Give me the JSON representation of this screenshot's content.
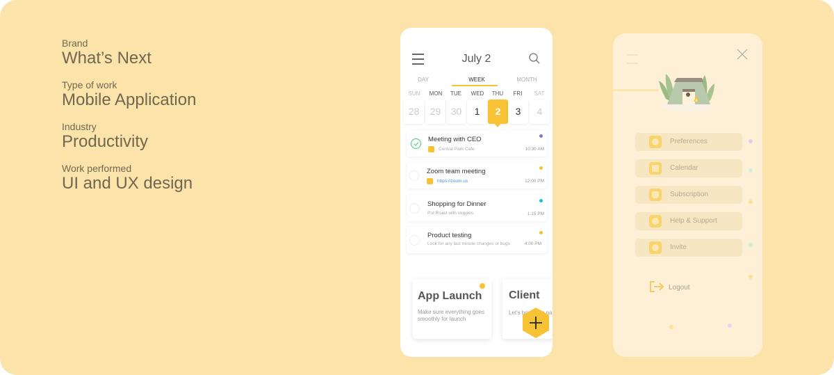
{
  "info": {
    "items": [
      {
        "label": "Brand",
        "value": "What’s Next"
      },
      {
        "label": "Type of work",
        "value": "Mobile Application"
      },
      {
        "label": "Industry",
        "value": "Productivity"
      },
      {
        "label": "Work performed",
        "value": "UI and UX design"
      }
    ]
  },
  "calendar": {
    "title": "July 2",
    "icons": {
      "menu": "menu-icon",
      "search": "search-icon"
    },
    "tabs": [
      {
        "label": "DAY",
        "active": false
      },
      {
        "label": "WEEK",
        "active": true
      },
      {
        "label": "MONTH",
        "active": false
      }
    ],
    "weekdays": [
      "SUN",
      "MON",
      "TUE",
      "WED",
      "THU",
      "FRI",
      "SAT"
    ],
    "days": [
      {
        "num": "28",
        "state": "past"
      },
      {
        "num": "29",
        "state": "past"
      },
      {
        "num": "30",
        "state": "past"
      },
      {
        "num": "1",
        "state": "normal"
      },
      {
        "num": "2",
        "state": "active"
      },
      {
        "num": "3",
        "state": "normal"
      },
      {
        "num": "4",
        "state": "past"
      }
    ],
    "events": [
      {
        "title": "Meeting with CEO",
        "subtitle": "Central Park Cafe",
        "subtitle_icon": "location-pin-icon",
        "time": "10:30 AM",
        "done": true,
        "dot_color": "#8b6fd9"
      },
      {
        "title": "Zoom team meeting",
        "subtitle": "https://zoom.us",
        "subtitle_icon": "link-icon",
        "time": "12:00 PM",
        "done": false,
        "dot_color": "#f7c334"
      },
      {
        "title": "Shopping for Dinner",
        "subtitle": "Pot Roast with veggies",
        "time": "1:15 PM",
        "done": false,
        "dot_color": "#1cc2d6"
      },
      {
        "title": "Product testing",
        "subtitle": "Look for any last minute changes or bugs",
        "time": "4:00 PM",
        "done": false,
        "dot_color": "#f7c334"
      }
    ],
    "projects": [
      {
        "title": "App Launch",
        "description_line1": "Make sure everything goes",
        "description_line2": "smoothly for launch"
      },
      {
        "title": "Client",
        "description_line1": "Let's bring this ga",
        "description_line2": ""
      }
    ],
    "fab_icon": "plus-icon"
  },
  "side_menu": {
    "close_icon": "close-icon",
    "illustration": "camping-tent-illustration",
    "items": [
      {
        "label": "Preferences",
        "icon": "preferences-icon",
        "dot_color": "#d9c8e6"
      },
      {
        "label": "Calendar",
        "icon": "calendar-icon",
        "dot_color": "#c7eed6"
      },
      {
        "label": "Subscription",
        "icon": "subscription-icon",
        "dot_color": "#fbe39a"
      },
      {
        "label": "Help & Support",
        "icon": "help-icon",
        "dot_color": null
      },
      {
        "label": "Invite",
        "icon": "invite-icon",
        "dot_color": "#c7eed6"
      }
    ],
    "logout": {
      "label": "Logout",
      "icon": "logout-icon"
    }
  },
  "colors": {
    "background": "#fce3aa",
    "accent": "#f7c334",
    "text": "#6f6750"
  }
}
